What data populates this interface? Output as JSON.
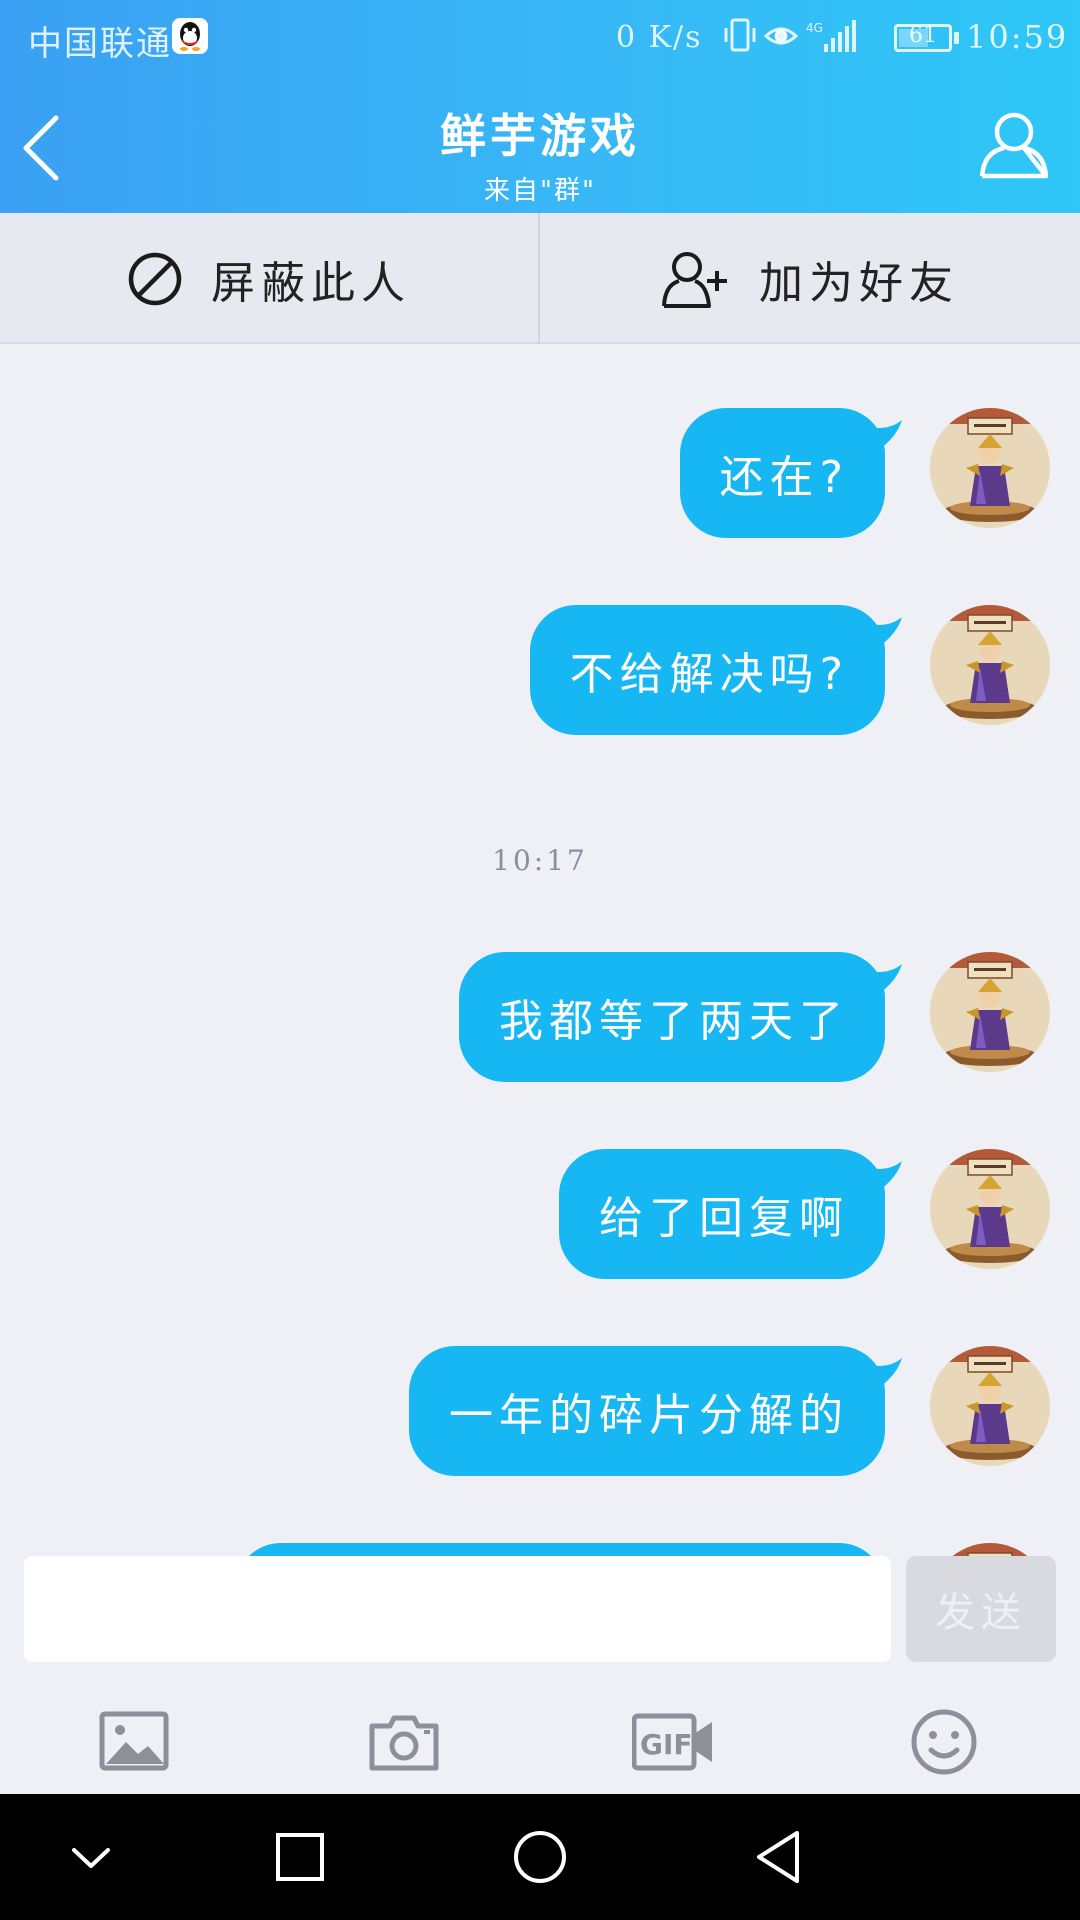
{
  "status_bar": {
    "carrier": "中国联通",
    "net_speed": "0 K/s",
    "network_type": "4G",
    "battery": "61",
    "battery_level": 0.61,
    "time": "10:59"
  },
  "header": {
    "title": "鲜芋游戏",
    "subtitle": "来自\"群\"",
    "icons": {
      "back": "back-chevron-icon",
      "profile": "person-icon"
    }
  },
  "actions": {
    "block_label": "屏蔽此人",
    "add_friend_label": "加为好友"
  },
  "messages": [
    {
      "text": "还在?"
    },
    {
      "text": "不给解决吗?"
    },
    {
      "text": "我都等了两天了"
    },
    {
      "text": "给了回复啊"
    },
    {
      "text": "一年的碎片分解的"
    }
  ],
  "timestamp": "10:17",
  "composer": {
    "input_value": "",
    "send_label": "发送",
    "tools": [
      "image-icon",
      "camera-icon",
      "gif-icon",
      "emoji-icon"
    ]
  },
  "colors": {
    "header_start": "#3aa0f3",
    "header_end": "#2ec7f7",
    "bubble": "#16b7f3",
    "background": "#eef0f6"
  }
}
